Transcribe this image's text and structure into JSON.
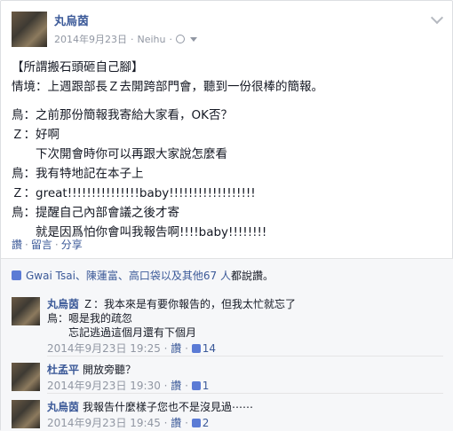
{
  "post": {
    "author": "丸烏茵",
    "timestamp": "2014年9月23日",
    "location": "Neihu",
    "privacy_icon": "globe-icon",
    "lines": [
      "【所謂搬石頭砸自己腳】",
      "情境：上週跟部長Ｚ去開跨部門會，聽到一份很棒的簡報。",
      "",
      "鳥：之前那份簡報我寄給大家看，OK否？",
      "Ｚ：好啊",
      "　　下次開會時你可以再跟大家說怎麼看",
      "鳥：我有特地記在本子上",
      "Ｚ：great!!!!!!!!!!!!!!!baby!!!!!!!!!!!!!!!!!!",
      "鳥：提醒自己內部會議之後才寄",
      "　　就是因爲怕你會叫我報告啊!!!!baby!!!!!!!!"
    ],
    "actions": {
      "like": "讚",
      "comment": "留言",
      "share": "分享"
    }
  },
  "likes": {
    "text_prefix": "Gwai Tsai",
    "names": "、陳蓮富、高口袋以及其他",
    "count_link": "67 人",
    "suffix": "都說讚。"
  },
  "comments": [
    {
      "author": "丸烏茵",
      "text": "Ｚ：我本來是有要你報告的，但我太忙就忘了",
      "extra": [
        "鳥：嗯是我的疏忽",
        "　　忘記逃過這個月還有下個月"
      ],
      "time": "2014年9月23日 19:25",
      "like": "讚",
      "likes": "14"
    },
    {
      "author": "杜孟平",
      "text": "開放旁聽？",
      "extra": [],
      "time": "2014年9月23日 19:30",
      "like": "讚",
      "likes": "1"
    },
    {
      "author": "丸烏茵",
      "text": "我報告什麼樣子您也不是沒見過⋯⋯",
      "extra": [],
      "time": "2014年9月23日 19:45",
      "like": "讚",
      "likes": "2"
    }
  ],
  "colors": {
    "link": "#3b5998",
    "muted": "#9197a3",
    "panel": "#f6f7f9"
  }
}
